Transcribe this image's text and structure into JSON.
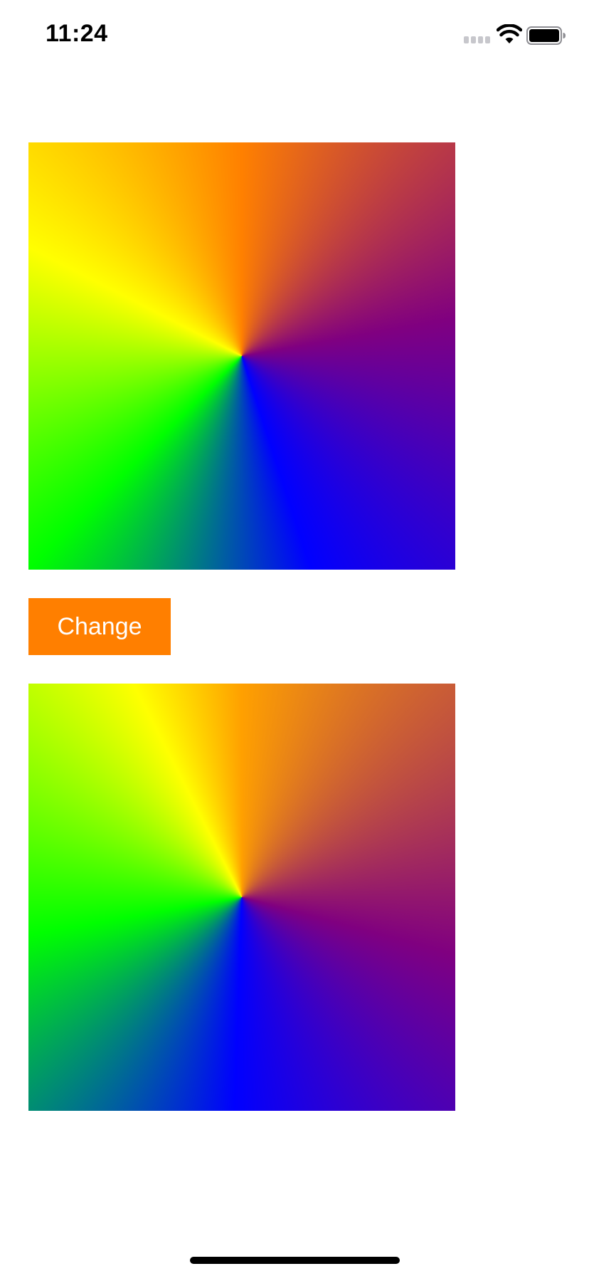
{
  "status_bar": {
    "time": "11:24",
    "signal_icon": "cellular-signal-icon",
    "wifi_icon": "wifi-icon",
    "battery_icon": "battery-icon"
  },
  "top_gradient": {
    "type": "conic-gradient"
  },
  "change_button": {
    "label": "Change",
    "background": "#ff7f00",
    "text_color": "#ffffff"
  },
  "bottom_gradient": {
    "type": "conic-gradient"
  },
  "home_indicator": {
    "color": "#000000"
  }
}
